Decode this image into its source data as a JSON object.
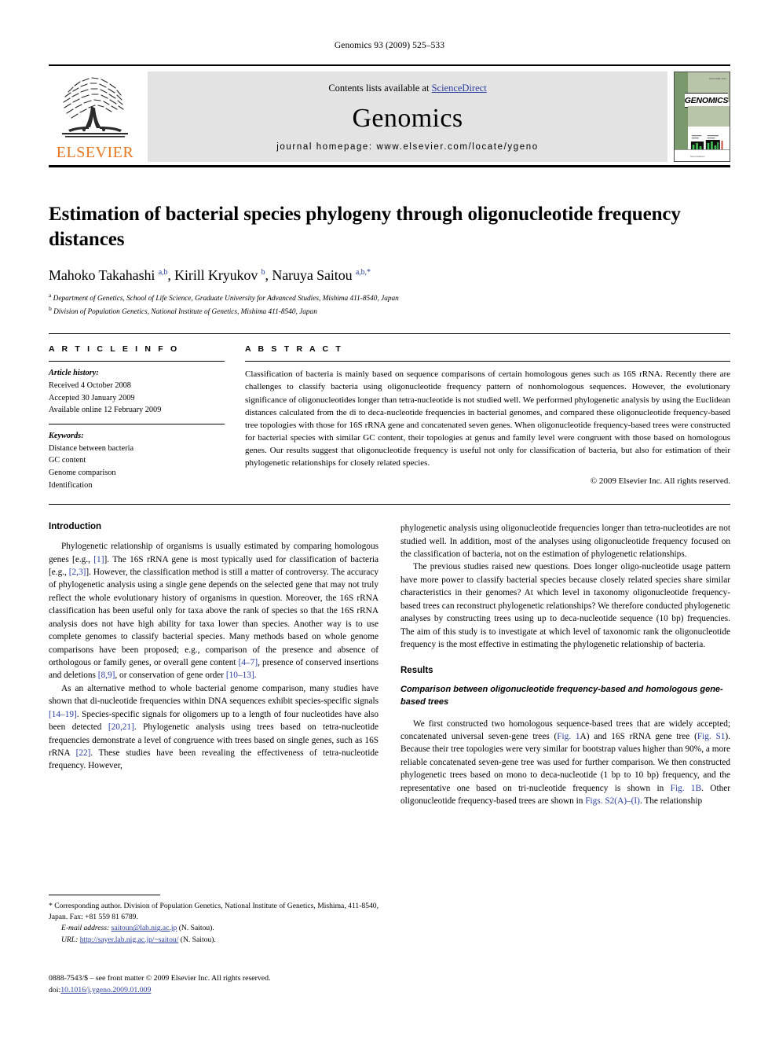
{
  "running_head": "Genomics 93 (2009) 525–533",
  "masthead": {
    "contents_prefix": "Contents lists available at ",
    "sciencedirect": "ScienceDirect",
    "journal_name": "Genomics",
    "homepage": "journal homepage: www.elsevier.com/locate/ygeno",
    "publisher_logo_text": "ELSEVIER",
    "publisher_logo_icon": "elsevier-tree-icon",
    "cover": {
      "title": "GENOMICS",
      "top_caption": "ISSN 0888-7543",
      "footer_caption": "ScienceDirect",
      "band_color": "#b9c5a8",
      "spine_color": "#7a9a6e"
    },
    "link_color": "#2a3d9e"
  },
  "article": {
    "title": "Estimation of bacterial species phylogeny through oligonucleotide frequency distances",
    "authors_html": "Mahoko Takahashi <sup>a,b</sup>, Kirill Kryukov <sup>b</sup>, Naruya Saitou <sup>a,b,</sup><sup>*</sup>",
    "affiliations": [
      {
        "marker": "a",
        "text": "Department of Genetics, School of Life Science, Graduate University for Advanced Studies, Mishima 411-8540, Japan"
      },
      {
        "marker": "b",
        "text": "Division of Population Genetics, National Institute of Genetics, Mishima 411-8540, Japan"
      }
    ]
  },
  "article_info": {
    "heading": "A R T I C L E    I N F O",
    "history_label": "Article history:",
    "history": [
      "Received 4 October 2008",
      "Accepted 30 January 2009",
      "Available online 12 February 2009"
    ],
    "keywords_label": "Keywords:",
    "keywords": [
      "Distance between bacteria",
      "GC content",
      "Genome comparison",
      "Identification"
    ]
  },
  "abstract": {
    "heading": "A B S T R A C T",
    "text": "Classification of bacteria is mainly based on sequence comparisons of certain homologous genes such as 16S rRNA. Recently there are challenges to classify bacteria using oligonucleotide frequency pattern of nonhomologous sequences. However, the evolutionary significance of oligonucleotides longer than tetra-nucleotide is not studied well. We performed phylogenetic analysis by using the Euclidean distances calculated from the di to deca-nucleotide frequencies in bacterial genomes, and compared these oligonucleotide frequency-based tree topologies with those for 16S rRNA gene and concatenated seven genes. When oligonucleotide frequency-based trees were constructed for bacterial species with similar GC content, their topologies at genus and family level were congruent with those based on homologous genes. Our results suggest that oligonucleotide frequency is useful not only for classification of bacteria, but also for estimation of their phylogenetic relationships for closely related species.",
    "copyright": "© 2009 Elsevier Inc. All rights reserved."
  },
  "body": {
    "introduction_heading": "Introduction",
    "results_heading": "Results",
    "results_subheading": "Comparison between oligonucleotide frequency-based and homologous gene-based trees",
    "left_paragraphs": [
      "Phylogenetic relationship of organisms is usually estimated by comparing homologous genes [e.g., <span class=\"cite\">[1]</span>]. The 16S rRNA gene is most typically used for classification of bacteria [e.g., <span class=\"cite\">[2,3]</span>]. However, the classification method is still a matter of controversy. The accuracy of phylogenetic analysis using a single gene depends on the selected gene that may not truly reflect the whole evolutionary history of organisms in question. Moreover, the 16S rRNA classification has been useful only for taxa above the rank of species so that the 16S rRNA analysis does not have high ability for taxa lower than species. Another way is to use complete genomes to classify bacterial species. Many methods based on whole genome comparisons have been proposed; e.g., comparison of the presence and absence of orthologous or family genes, or overall gene content <span class=\"cite\">[4–7]</span>, presence of conserved insertions and deletions <span class=\"cite\">[8,9]</span>, or conservation of gene order <span class=\"cite\">[10–13]</span>.",
      "As an alternative method to whole bacterial genome comparison, many studies have shown that di-nucleotide frequencies within DNA sequences exhibit species-specific signals <span class=\"cite\">[14–19]</span>. Species-specific signals for oligomers up to a length of four nucleotides have also been detected <span class=\"cite\">[20,21]</span>. Phylogenetic analysis using trees based on tetra-nucleotide frequencies demonstrate a level of congruence with trees based on single genes, such as 16S rRNA <span class=\"cite\">[22]</span>. These studies have been revealing the effectiveness of tetra-nucleotide frequency. However,"
    ],
    "right_paragraphs_intro": [
      "phylogenetic analysis using oligonucleotide frequencies longer than tetra-nucleotides are not studied well. In addition, most of the analyses using oligonucleotide frequency focused on the classification of bacteria, not on the estimation of phylogenetic relationships.",
      "The previous studies raised new questions. Does longer oligo-nucleotide usage pattern have more power to classify bacterial species because closely related species share similar characteristics in their genomes? At which level in taxonomy oligonucleotide frequency-based trees can reconstruct phylogenetic relationships? We therefore conducted phylogenetic analyses by constructing trees using up to deca-nucleotide sequence (10 bp) frequencies. The aim of this study is to investigate at which level of taxonomic rank the oligonucleotide frequency is the most effective in estimating the phylogenetic relationship of bacteria."
    ],
    "right_paragraphs_results": [
      "We first constructed two homologous sequence-based trees that are widely accepted; concatenated universal seven-gene trees (<span class=\"cite\">Fig. 1</span>A) and 16S rRNA gene tree (<span class=\"cite\">Fig. S1</span>). Because their tree topologies were very similar for bootstrap values higher than 90%, a more reliable concatenated seven-gene tree was used for further comparison. We then constructed phylogenetic trees based on mono to deca-nucleotide (1 bp to 10 bp) frequency, and the representative one based on tri-nucleotide frequency is shown in <span class=\"cite\">Fig. 1B</span>. Other oligonucleotide frequency-based trees are shown in <span class=\"cite\">Figs. S2(A)–(I)</span>. The relationship"
    ]
  },
  "footnotes": {
    "corresponding": "* Corresponding author. Division of Population Genetics, National Institute of Genetics, Mishima, 411-8540, Japan. Fax: +81 559 81 6789.",
    "email_label": "E-mail address:",
    "email": "saitoun@lab.nig.ac.jp",
    "email_owner": "(N. Saitou).",
    "url_label": "URL:",
    "url": "http://sayer.lab.nig.ac.jp/~saitou/",
    "url_owner": "(N. Saitou)."
  },
  "imprint": {
    "front_matter": "0888-7543/$ – see front matter © 2009 Elsevier Inc. All rights reserved.",
    "doi_label": "doi:",
    "doi": "10.1016/j.ygeno.2009.01.009"
  }
}
